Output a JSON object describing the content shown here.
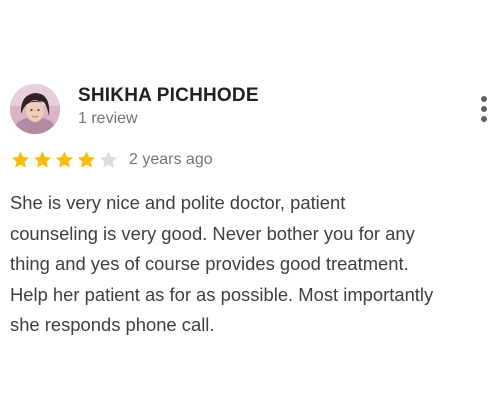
{
  "reviewer": {
    "name": "SHIKHA PICHHODE",
    "review_count": "1 review",
    "avatar_icon": "profile-photo"
  },
  "rating": {
    "stars": 4,
    "max_stars": 5,
    "filled_color": "#fbbc04",
    "empty_color": "#dadce0",
    "date": "2 years ago"
  },
  "review": {
    "lines": [
      "She is very nice and polite doctor, patient",
      "counseling is very good. Never bother you for any",
      "thing and yes of course provides good treatment.",
      "Help her patient as for as possible. Most importantly",
      "she responds phone call."
    ]
  },
  "menu": {
    "icon": "more-vert-icon"
  }
}
